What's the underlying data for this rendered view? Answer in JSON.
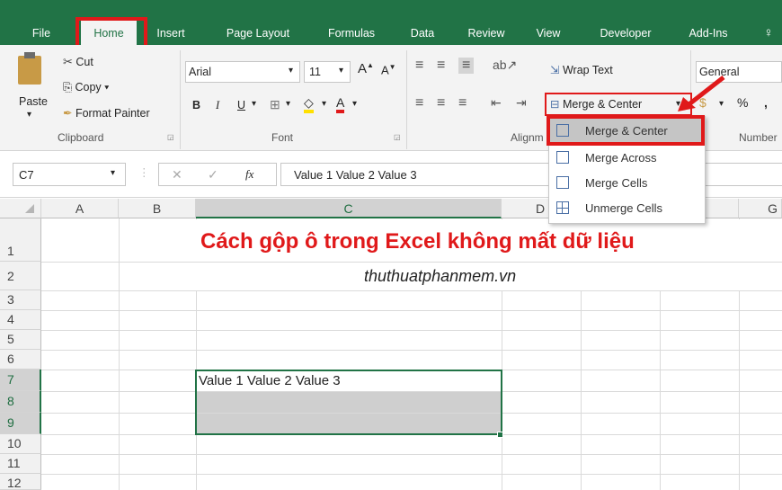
{
  "tabs": [
    {
      "label": "File"
    },
    {
      "label": "Home"
    },
    {
      "label": "Insert"
    },
    {
      "label": "Page Layout"
    },
    {
      "label": "Formulas"
    },
    {
      "label": "Data"
    },
    {
      "label": "Review"
    },
    {
      "label": "View"
    },
    {
      "label": "Developer"
    },
    {
      "label": "Add-Ins"
    }
  ],
  "clipboard": {
    "paste": "Paste",
    "cut": "Cut",
    "copy": "Copy",
    "format_painter": "Format Painter",
    "group": "Clipboard"
  },
  "font": {
    "name": "Arial",
    "size": "11",
    "bold": "B",
    "italic": "I",
    "underline": "U",
    "group": "Font"
  },
  "alignment": {
    "wrap_text": "Wrap Text",
    "merge_center": "Merge & Center",
    "group": "Alignm"
  },
  "number": {
    "format": "General",
    "percent": "%",
    "comma": ",",
    "group": "Number"
  },
  "formula_bar": {
    "name_box": "C7",
    "fx": "fx",
    "formula": "Value 1 Value 2 Value 3",
    "cancel": "✕",
    "enter": "✓"
  },
  "columns": [
    "A",
    "B",
    "C",
    "D",
    "G"
  ],
  "rows": [
    "1",
    "2",
    "3",
    "4",
    "5",
    "6",
    "7",
    "8",
    "9",
    "10",
    "11",
    "12"
  ],
  "cells": {
    "title": "Cách gộp ô trong Excel không mất dữ liệu",
    "subtitle": "thuthuatphanmem.vn",
    "c7": "Value 1 Value 2 Value 3"
  },
  "merge_menu": [
    {
      "label": "Merge & Center"
    },
    {
      "label": "Merge Across"
    },
    {
      "label": "Merge Cells"
    },
    {
      "label": "Unmerge Cells"
    }
  ],
  "colors": {
    "excel_green": "#217346",
    "highlight_red": "#e0191a",
    "title_red": "#e0191a"
  }
}
